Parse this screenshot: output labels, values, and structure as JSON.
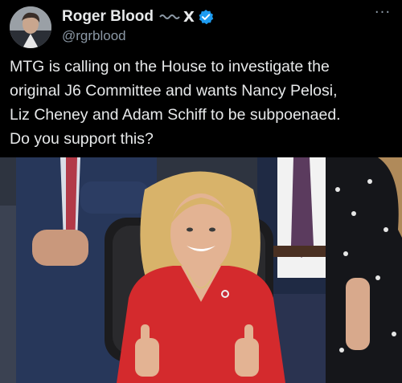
{
  "author": {
    "display_name": "Roger Blood",
    "handle": "@rgrblood",
    "x_badge": "X",
    "verified": true,
    "verified_color": "#1d9bf0"
  },
  "post": {
    "text_lines": [
      "MTG is calling on the House to investigate the",
      "original J6 Committee and wants Nancy Pelosi,",
      "Liz Cheney and Adam Schiff to be subpoenaed.",
      "Do you support this?"
    ]
  },
  "icons": {
    "more": "more-horizontal-icon",
    "verified": "verified-badge-icon"
  },
  "colors": {
    "background": "#000000",
    "text": "#e7e9ea",
    "secondary_text": "#8b98a5",
    "accent": "#1d9bf0"
  }
}
